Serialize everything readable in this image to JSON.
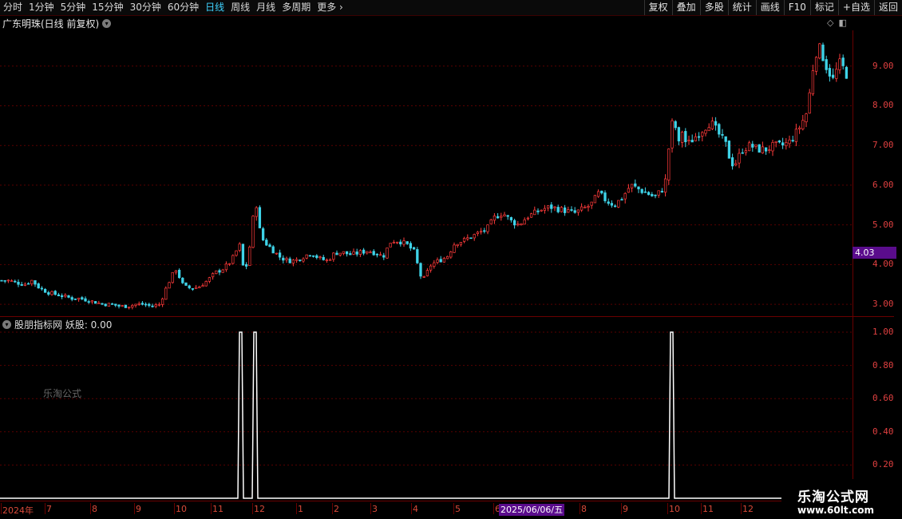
{
  "toolbar": {
    "periods": [
      "分时",
      "1分钟",
      "5分钟",
      "15分钟",
      "30分钟",
      "60分钟",
      "日线",
      "周线",
      "月线",
      "多周期"
    ],
    "active_period": "日线",
    "more": "更多",
    "right_buttons": [
      "复权",
      "叠加",
      "多股",
      "统计",
      "画线",
      "F10",
      "标记",
      "+自选",
      "返回"
    ]
  },
  "main_chart": {
    "title": "广东明珠(日线 前复权)",
    "price_axis": [
      "9.00",
      "8.00",
      "7.00",
      "6.00",
      "5.00",
      "4.00",
      "3.00"
    ],
    "current_price_tag": "4.03",
    "up_color": "#ff3b3b",
    "down_color": "#3fd3e8"
  },
  "indicator": {
    "title": "股朋指标网 妖股: 0.00",
    "axis": [
      "1.00",
      "0.80",
      "0.60",
      "0.40",
      "0.20"
    ],
    "watermark": "乐淘公式"
  },
  "date_axis": {
    "labels": [
      "2024年",
      "7",
      "8",
      "9",
      "10",
      "11",
      "12",
      "1",
      "2",
      "3",
      "4",
      "5",
      "6",
      "2025/06/06/五",
      "8",
      "9",
      "10",
      "11",
      "12"
    ],
    "selected": "2025/06/06/五"
  },
  "brand": {
    "name": "乐淘公式网",
    "url": "www.60lt.com"
  },
  "chart_data": {
    "type": "candlestick",
    "title": "广东明珠(日线 前复权)",
    "ylim": [
      2.7,
      9.9
    ],
    "x_months": [
      "2024-06",
      "2024-07",
      "2024-08",
      "2024-09",
      "2024-10",
      "2024-11",
      "2024-12",
      "2025-01",
      "2025-02",
      "2025-03",
      "2025-04",
      "2025-05",
      "2025-06",
      "2025-07",
      "2025-08",
      "2025-09",
      "2025-10",
      "2025-11",
      "2025-12"
    ],
    "close_path": [
      [
        0,
        3.6
      ],
      [
        10,
        3.6
      ],
      [
        20,
        3.55
      ],
      [
        30,
        3.5
      ],
      [
        40,
        3.6
      ],
      [
        50,
        3.4
      ],
      [
        60,
        3.3
      ],
      [
        70,
        3.25
      ],
      [
        80,
        3.2
      ],
      [
        90,
        3.15
      ],
      [
        100,
        3.15
      ],
      [
        110,
        3.1
      ],
      [
        120,
        3.05
      ],
      [
        130,
        3.0
      ],
      [
        140,
        3.0
      ],
      [
        150,
        2.95
      ],
      [
        160,
        2.95
      ],
      [
        170,
        3.0
      ],
      [
        180,
        3.0
      ],
      [
        190,
        2.95
      ],
      [
        200,
        3.0
      ],
      [
        210,
        3.5
      ],
      [
        220,
        3.9
      ],
      [
        230,
        3.45
      ],
      [
        240,
        3.4
      ],
      [
        250,
        3.45
      ],
      [
        260,
        3.6
      ],
      [
        270,
        3.8
      ],
      [
        280,
        3.9
      ],
      [
        290,
        4.1
      ],
      [
        300,
        4.5
      ],
      [
        305,
        3.9
      ],
      [
        310,
        4.0
      ],
      [
        315,
        4.8
      ],
      [
        320,
        5.7
      ],
      [
        325,
        4.9
      ],
      [
        330,
        4.6
      ],
      [
        340,
        4.4
      ],
      [
        350,
        4.2
      ],
      [
        360,
        4.1
      ],
      [
        370,
        4.1
      ],
      [
        380,
        4.2
      ],
      [
        390,
        4.3
      ],
      [
        400,
        4.15
      ],
      [
        410,
        4.1
      ],
      [
        420,
        4.3
      ],
      [
        430,
        4.3
      ],
      [
        440,
        4.25
      ],
      [
        450,
        4.3
      ],
      [
        460,
        4.35
      ],
      [
        470,
        4.3
      ],
      [
        480,
        4.2
      ],
      [
        490,
        4.6
      ],
      [
        500,
        4.6
      ],
      [
        510,
        4.5
      ],
      [
        520,
        4.3
      ],
      [
        525,
        3.8
      ],
      [
        530,
        3.6
      ],
      [
        540,
        4.0
      ],
      [
        550,
        4.1
      ],
      [
        560,
        4.2
      ],
      [
        570,
        4.55
      ],
      [
        580,
        4.6
      ],
      [
        590,
        4.7
      ],
      [
        600,
        4.8
      ],
      [
        610,
        4.9
      ],
      [
        620,
        5.2
      ],
      [
        630,
        5.3
      ],
      [
        640,
        5.1
      ],
      [
        650,
        5.0
      ],
      [
        660,
        5.2
      ],
      [
        670,
        5.3
      ],
      [
        680,
        5.4
      ],
      [
        690,
        5.45
      ],
      [
        700,
        5.4
      ],
      [
        710,
        5.35
      ],
      [
        720,
        5.3
      ],
      [
        730,
        5.4
      ],
      [
        740,
        5.5
      ],
      [
        750,
        5.8
      ],
      [
        760,
        5.6
      ],
      [
        770,
        5.5
      ],
      [
        780,
        5.7
      ],
      [
        790,
        6.0
      ],
      [
        800,
        5.9
      ],
      [
        810,
        5.8
      ],
      [
        820,
        5.7
      ],
      [
        830,
        5.9
      ],
      [
        835,
        6.2
      ],
      [
        840,
        7.5
      ],
      [
        845,
        7.6
      ],
      [
        850,
        7.0
      ],
      [
        855,
        7.4
      ],
      [
        860,
        7.0
      ],
      [
        870,
        7.2
      ],
      [
        880,
        7.4
      ],
      [
        890,
        7.6
      ],
      [
        900,
        7.3
      ],
      [
        910,
        7.0
      ],
      [
        915,
        6.6
      ],
      [
        920,
        6.5
      ],
      [
        930,
        6.9
      ],
      [
        940,
        7.0
      ],
      [
        950,
        6.9
      ],
      [
        960,
        6.9
      ],
      [
        970,
        7.0
      ],
      [
        980,
        7.0
      ],
      [
        990,
        7.1
      ],
      [
        1000,
        7.4
      ],
      [
        1010,
        7.8
      ],
      [
        1015,
        8.4
      ],
      [
        1020,
        9.2
      ],
      [
        1025,
        9.5
      ],
      [
        1030,
        9.3
      ],
      [
        1035,
        9.0
      ],
      [
        1040,
        8.8
      ],
      [
        1045,
        8.6
      ],
      [
        1050,
        9.1
      ],
      [
        1055,
        9.0
      ],
      [
        1060,
        8.8
      ]
    ],
    "indicator_series": {
      "name": "妖股",
      "value_now": 0.0,
      "spikes_at": [
        300,
        318,
        840
      ],
      "spike_value": 1.0
    }
  }
}
